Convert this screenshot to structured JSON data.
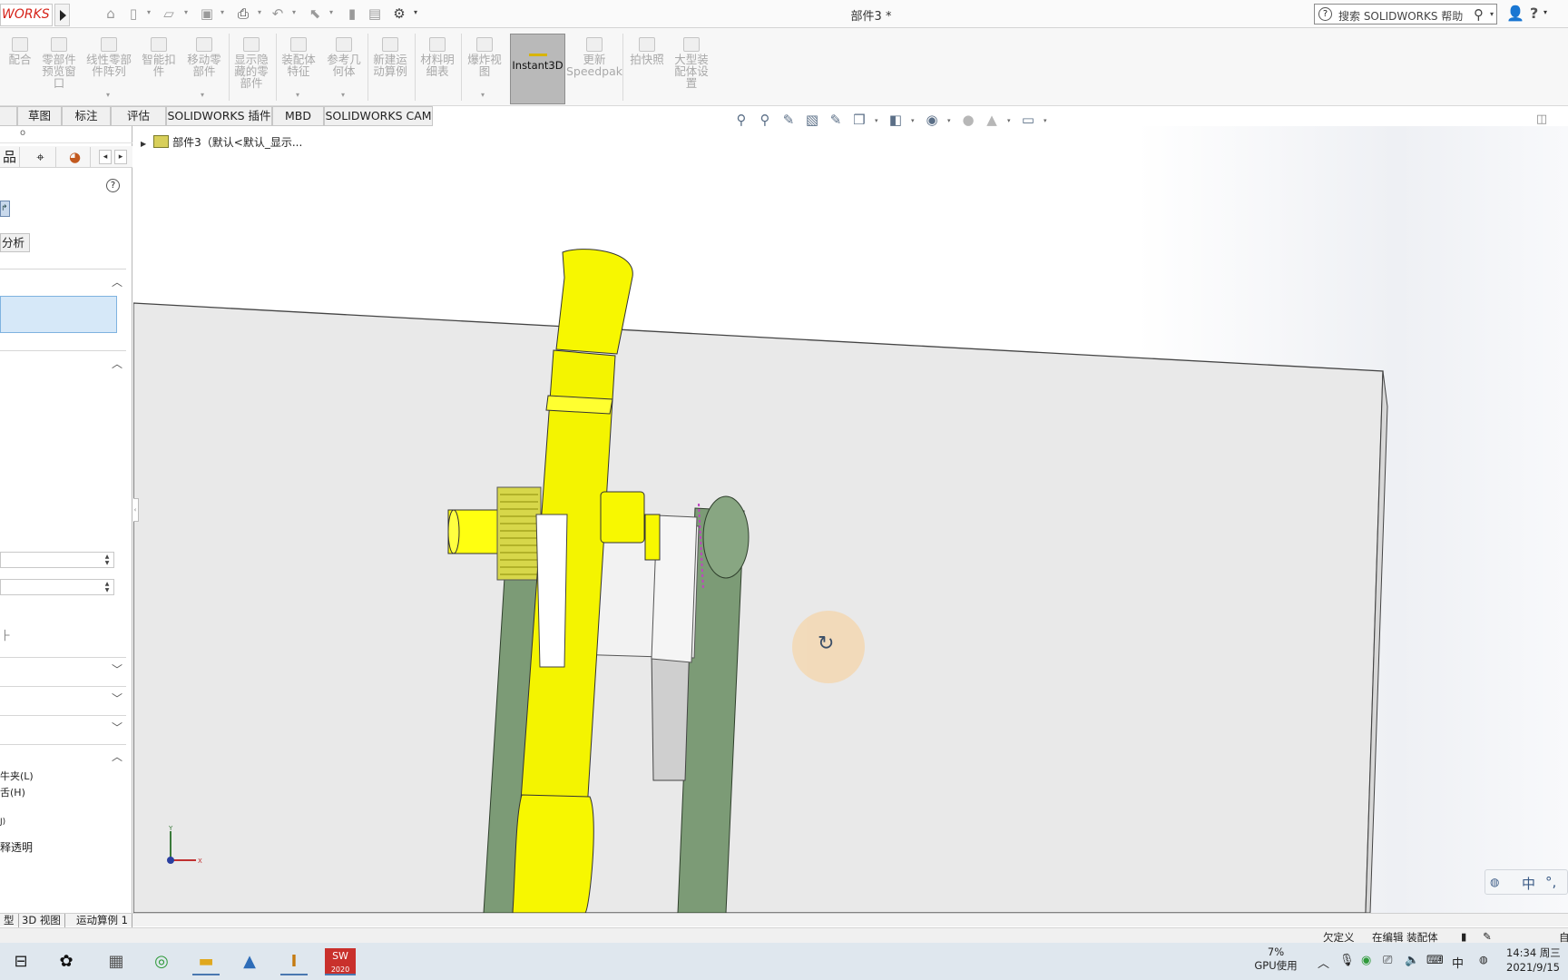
{
  "app": {
    "logo_text": "WORKS",
    "document_title": "部件3 *",
    "help_search_placeholder": "搜索 SOLIDWORKS 帮助"
  },
  "quick_access": [
    "home-icon",
    "new-icon",
    "open-icon",
    "save-icon",
    "print-icon",
    "undo-icon",
    "select-icon",
    "rebuild-icon",
    "file-properties-icon",
    "options-icon"
  ],
  "ribbon": {
    "buttons": [
      {
        "label": "配合"
      },
      {
        "label": "零部件\n预览窗\n口"
      },
      {
        "label": "线性零部\n件阵列"
      },
      {
        "label": "智能扣\n件"
      },
      {
        "label": "移动零\n部件"
      },
      {
        "label": "显示隐\n藏的零\n部件"
      },
      {
        "label": "装配体\n特征"
      },
      {
        "label": "参考几\n何体"
      },
      {
        "label": "新建运\n动算例"
      },
      {
        "label": "材料明\n细表"
      },
      {
        "label": "爆炸视\n图"
      },
      {
        "label": "Instant3D"
      },
      {
        "label": "更新\nSpeedpak"
      },
      {
        "label": "拍快照"
      },
      {
        "label": "大型装\n配体设\n置"
      }
    ]
  },
  "cm_tabs": [
    "草图",
    "标注",
    "评估",
    "SOLIDWORKS 插件",
    "MBD",
    "SOLIDWORKS CAM"
  ],
  "left_panel": {
    "top_marker": "o",
    "tabs": [
      "config-manager-icon",
      "target-icon",
      "appearance-icon"
    ],
    "analysis_button": "分析",
    "options": [
      "牛夹(L)",
      "舌(H)",
      "J)",
      "释透明"
    ]
  },
  "feature_tree": {
    "root_label": "部件3（默认<默认_显示..."
  },
  "bottom_tabs": [
    "型",
    "3D 视图",
    "运动算例 1"
  ],
  "status_bar": {
    "definition": "欠定义",
    "editing": "在编辑 装配体",
    "right_edge": "自"
  },
  "taskbar": {
    "apps": [
      "task-view-icon",
      "app-s-icon",
      "calculator-icon",
      "browser-icon",
      "file-explorer-icon",
      "photos-icon",
      "app-i-icon",
      "solidworks-2020-icon"
    ],
    "sw_label": "2020",
    "gpu_percent": "7%",
    "gpu_label": "GPU使用",
    "time": "14:34 周三",
    "date": "2021/9/15"
  },
  "ime": {
    "lang": "中"
  },
  "colors": {
    "yellow_part": "#ffff00",
    "green_part": "#7a9a74",
    "white_part": "#eeeeee",
    "plate": "#e8e8e8",
    "sw_red": "#d6241b"
  }
}
